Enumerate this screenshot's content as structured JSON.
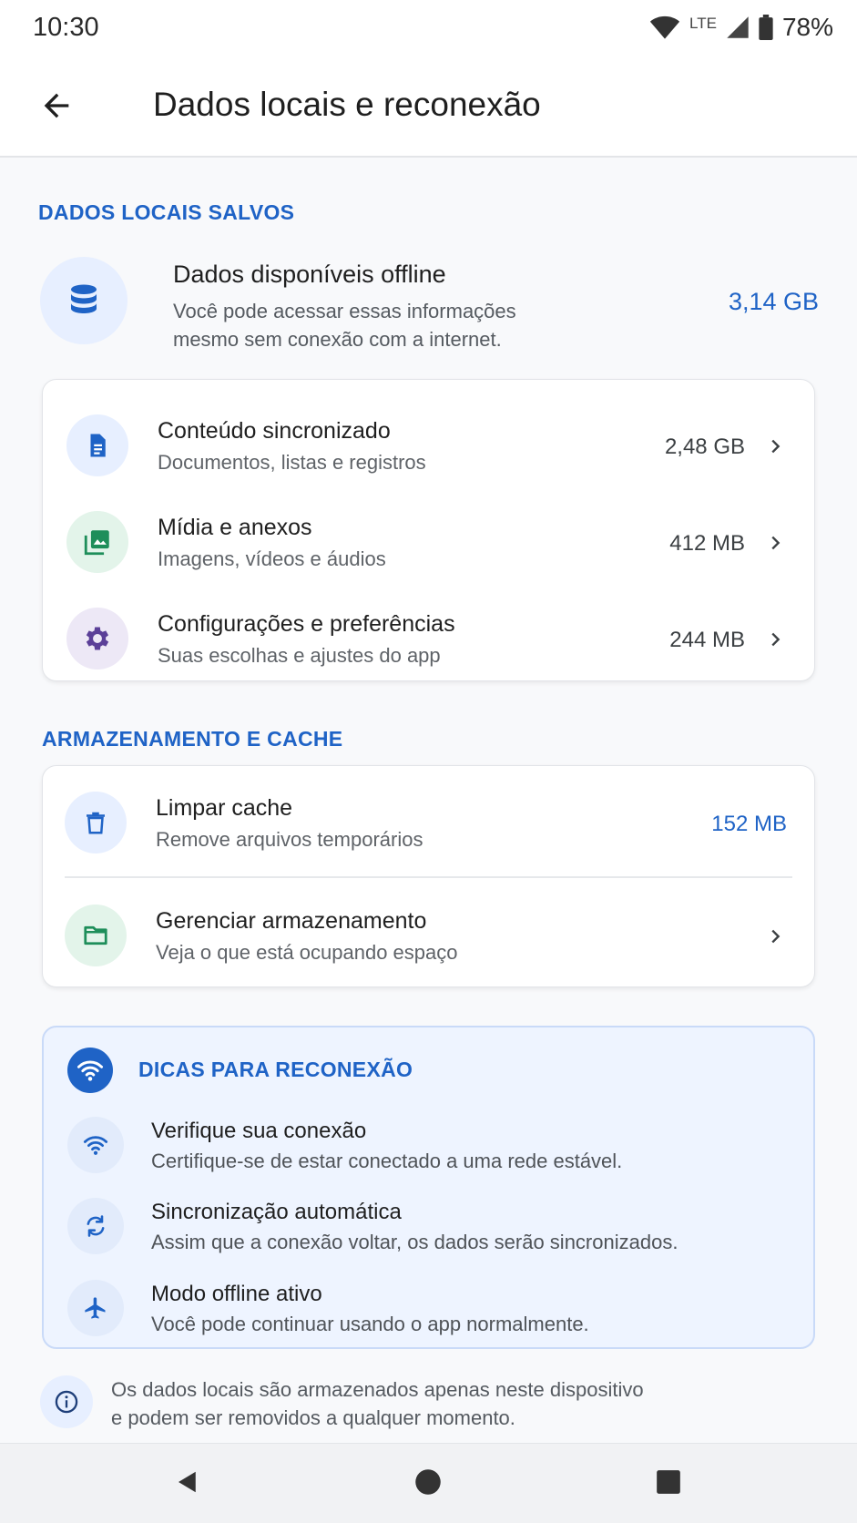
{
  "status_bar": {
    "time": "10:30",
    "network": "LTE",
    "battery": "78%",
    "icons": [
      "wifi-icon",
      "signal-icon",
      "battery-icon"
    ]
  },
  "app_bar": {
    "title": "Dados locais e reconexão",
    "back_icon": "arrow-back-icon"
  },
  "saved_section": {
    "label": "DADOS LOCAIS SALVOS",
    "offline": {
      "icon": "database-icon",
      "title": "Dados disponíveis offline",
      "description": "Você pode acessar essas informações mesmo sem conexão com a internet.",
      "size": "3,14 GB"
    },
    "items": [
      {
        "icon": "document-icon",
        "title": "Conteúdo sincronizado",
        "subtitle": "Documentos, listas e registros",
        "size": "2,48 GB"
      },
      {
        "icon": "image-icon",
        "title": "Mídia e anexos",
        "subtitle": "Imagens, vídeos e áudios",
        "size": "412 MB"
      },
      {
        "icon": "gear-icon",
        "title": "Configurações e preferências",
        "subtitle": "Suas escolhas e ajustes do app",
        "size": "244 MB"
      }
    ]
  },
  "storage_section": {
    "label": "ARMAZENAMENTO E CACHE",
    "clear_cache": {
      "icon": "trash-icon",
      "title": "Limpar cache",
      "subtitle": "Remove arquivos temporários",
      "size": "152 MB"
    },
    "manage": {
      "icon": "folder-icon",
      "title": "Gerenciar armazenamento",
      "subtitle": "Veja o que está ocupando espaço"
    }
  },
  "tips": {
    "title": "DICAS PARA RECONEXÃO",
    "items": [
      {
        "icon": "wifi-icon",
        "title": "Verifique sua conexão",
        "subtitle": "Certifique-se de estar conectado a uma rede estável."
      },
      {
        "icon": "sync-icon",
        "title": "Sincronização automática",
        "subtitle": "Assim que a conexão voltar, os dados serão sincronizados."
      },
      {
        "icon": "airplane-icon",
        "title": "Modo offline ativo",
        "subtitle": "Você pode continuar usando o app normalmente."
      }
    ]
  },
  "note": {
    "icon": "info-icon",
    "text_line1": "Os dados locais são armazenados apenas neste dispositivo",
    "text_line2": "e podem ser removidos a qualquer momento."
  },
  "colors": {
    "accent": "#1f63c6",
    "tips_background": "#eef4ff",
    "media_green": "#1e8e5a",
    "settings_purple": "#5b3f98"
  }
}
